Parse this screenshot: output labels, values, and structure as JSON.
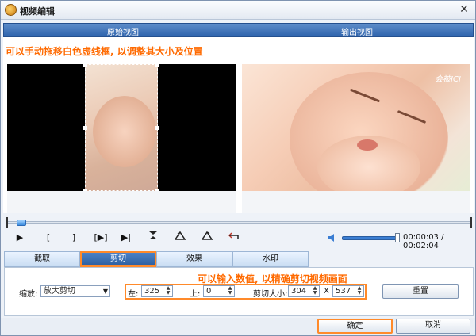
{
  "window": {
    "title": "视频编辑"
  },
  "views": {
    "original": "原始视图",
    "output": "输出视图"
  },
  "notes": {
    "drag": "可以手动拖移白色虚线框, 以调整其大小及位置",
    "input": "可以输入数值, 以精确剪切视频画面"
  },
  "preview": {
    "watermark": "会被ICI"
  },
  "controls": {
    "play": "▶",
    "mark_in": "[",
    "mark_out": "]",
    "clip": "[▶]",
    "next": "▶|",
    "time": "00:00:03 / 00:02:04"
  },
  "tabs": [
    {
      "label": "截取"
    },
    {
      "label": "剪切"
    },
    {
      "label": "效果"
    },
    {
      "label": "水印"
    }
  ],
  "crop": {
    "zoom_label": "缩放:",
    "zoom_value": "放大剪切",
    "left_label": "左:",
    "left_value": "325",
    "top_label": "上:",
    "top_value": "0",
    "size_label": "剪切大小:",
    "width_value": "304",
    "x_label": "X",
    "height_value": "537",
    "reset_label": "重置"
  },
  "footer": {
    "ok_label": "确定",
    "cancel_label": "取消"
  }
}
